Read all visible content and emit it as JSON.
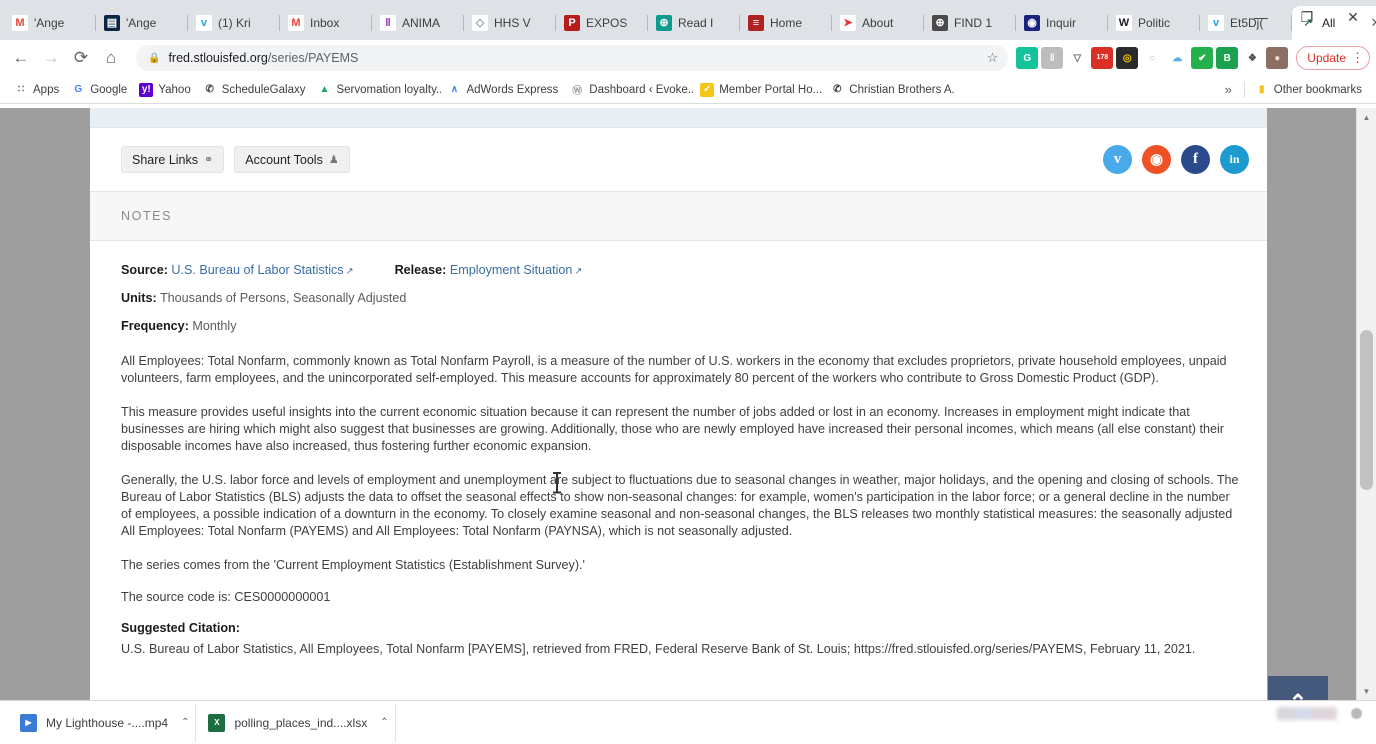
{
  "browser": {
    "tabs": [
      {
        "label": "'Ange",
        "favicon": "gmail-icon",
        "color": "#ea4335",
        "bg": "#ffffff",
        "glyph": "M",
        "active": false
      },
      {
        "label": "'Ange",
        "favicon": "handshake-icon",
        "color": "#ffffff",
        "bg": "#0b2545",
        "glyph": "▤",
        "active": false
      },
      {
        "label": "(1) Kri",
        "favicon": "twitter-icon",
        "color": "#1da1f2",
        "bg": "#ffffff",
        "glyph": "ᴠ",
        "active": false
      },
      {
        "label": "Inbox",
        "favicon": "gmail-icon",
        "color": "#ea4335",
        "bg": "#ffffff",
        "glyph": "M",
        "active": false
      },
      {
        "label": "ANIMA",
        "favicon": "bar-chart-icon",
        "color": "#8e24aa",
        "bg": "#ffffff",
        "glyph": "‖",
        "active": false
      },
      {
        "label": "HHS V",
        "favicon": "diamond-icon",
        "color": "#9aa0a6",
        "bg": "#ffffff",
        "glyph": "◇",
        "active": false
      },
      {
        "label": "EXPOS",
        "favicon": "pressreader-icon",
        "color": "#ffffff",
        "bg": "#b71c1c",
        "glyph": "P",
        "active": false
      },
      {
        "label": "Read I",
        "favicon": "globe-icon",
        "color": "#ffffff",
        "bg": "#0f9b8e",
        "glyph": "⊕",
        "active": false
      },
      {
        "label": "Home",
        "favicon": "flag-icon",
        "color": "#ffffff",
        "bg": "#b02121",
        "glyph": "≡",
        "active": false
      },
      {
        "label": "About",
        "favicon": "rocket-icon",
        "color": "#e53935",
        "bg": "#ffffff",
        "glyph": "➤",
        "active": false
      },
      {
        "label": "FIND 1",
        "favicon": "globe-dark-icon",
        "color": "#ffffff",
        "bg": "#4a4a4a",
        "glyph": "⊕",
        "active": false
      },
      {
        "label": "Inquir",
        "favicon": "record-icon",
        "color": "#ffffff",
        "bg": "#1a237e",
        "glyph": "◉",
        "active": false
      },
      {
        "label": "Politic",
        "favicon": "wikipedia-icon",
        "color": "#202124",
        "bg": "#ffffff",
        "glyph": "W",
        "active": false
      },
      {
        "label": "Et5Dj(",
        "favicon": "twitter-icon",
        "color": "#1da1f2",
        "bg": "#ffffff",
        "glyph": "ᴠ",
        "active": false
      },
      {
        "label": "All",
        "favicon": "fred-chart-icon",
        "color": "#2f6d4f",
        "bg": "#ffffff",
        "glyph": "↗",
        "active": true
      }
    ],
    "new_tab_label": "+",
    "window_controls": {
      "minimize": "—",
      "maximize": "❐",
      "close": "✕"
    },
    "nav": {
      "back": "←",
      "forward": "→",
      "reload": "⟳",
      "home": "⌂"
    },
    "omnibox": {
      "lock_icon": "lock-icon",
      "url_domain": "fred.stlouisfed.org",
      "url_path": "/series/PAYEMS",
      "bookmark_star": "☆"
    },
    "extensions": [
      {
        "name": "grammarly-extension",
        "glyph": "G",
        "bg": "#15c39a",
        "color": "#ffffff"
      },
      {
        "name": "gray-extension",
        "glyph": "‖",
        "bg": "#bdbdbd",
        "color": "#ffffff"
      },
      {
        "name": "shield-extension",
        "glyph": "▽",
        "bg": "#ffffff",
        "color": "#6b7280"
      },
      {
        "name": "gmail-checker-extension",
        "glyph": "178",
        "bg": "#d93025",
        "color": "#ffffff"
      },
      {
        "name": "clock-extension",
        "glyph": "◎",
        "bg": "#2b2b2b",
        "color": "#f6c700"
      },
      {
        "name": "circle-gray-extension",
        "glyph": "○",
        "bg": "#ffffff",
        "color": "#b0b0b0"
      },
      {
        "name": "cloud-extension",
        "glyph": "☁",
        "bg": "#ffffff",
        "color": "#5aaee0"
      },
      {
        "name": "checkmark-extension",
        "glyph": "✔",
        "bg": "#22b14c",
        "color": "#ffffff"
      },
      {
        "name": "bitly-extension",
        "glyph": "B",
        "bg": "#1ba14f",
        "color": "#ffffff"
      },
      {
        "name": "puzzle-extension",
        "glyph": "❖",
        "bg": "#ffffff",
        "color": "#4d5156"
      },
      {
        "name": "profile-avatar",
        "glyph": "●",
        "bg": "#8d6e63",
        "color": "#f3d9c8"
      }
    ],
    "update_button": {
      "label": "Update",
      "kebab": "⋮"
    },
    "bookmarks": [
      {
        "label": "Apps",
        "icon": "apps-grid-icon",
        "glyph": "∷",
        "bg": "#ffffff",
        "color": "#5f6368"
      },
      {
        "label": "Google",
        "icon": "google-icon",
        "glyph": "G",
        "bg": "#ffffff",
        "color": "#4285f4"
      },
      {
        "label": "Yahoo",
        "icon": "yahoo-icon",
        "glyph": "y!",
        "bg": "#6001d2",
        "color": "#ffffff"
      },
      {
        "label": "ScheduleGalaxy",
        "icon": "phone-icon",
        "glyph": "✆",
        "bg": "#ffffff",
        "color": "#3c4043"
      },
      {
        "label": "Servomation loyalty...",
        "icon": "google-drive-icon",
        "glyph": "▲",
        "bg": "#ffffff",
        "color": "#1aa260"
      },
      {
        "label": "AdWords Express",
        "icon": "adwords-icon",
        "glyph": "∧",
        "bg": "#ffffff",
        "color": "#4285f4"
      },
      {
        "label": "Dashboard ‹ Evoke...",
        "icon": "wordpress-icon",
        "glyph": "Ⓦ",
        "bg": "#ffffff",
        "color": "#9aa0a6"
      },
      {
        "label": "Member Portal Ho...",
        "icon": "check-badge-icon",
        "glyph": "✓",
        "bg": "#f5c518",
        "color": "#ffffff"
      },
      {
        "label": "Christian Brothers A...",
        "icon": "phone-icon",
        "glyph": "✆",
        "bg": "#ffffff",
        "color": "#3c4043"
      }
    ],
    "overflow_chevron": "»",
    "other_bookmarks": {
      "label": "Other bookmarks",
      "icon": "folder-icon",
      "glyph": "▮"
    }
  },
  "page": {
    "toolbar": {
      "share_links": {
        "label": "Share Links",
        "icon": "link-icon",
        "glyph": "⚭"
      },
      "account_tools": {
        "label": "Account Tools",
        "icon": "person-icon",
        "glyph": "♟"
      }
    },
    "social": [
      {
        "name": "twitter-share-icon",
        "glyph": "ᴠ",
        "bg": "#4aa9e8"
      },
      {
        "name": "reddit-share-icon",
        "glyph": "◉",
        "bg": "#ef5124"
      },
      {
        "name": "facebook-share-icon",
        "glyph": "f",
        "bg": "#2b4a8b"
      },
      {
        "name": "linkedin-share-icon",
        "glyph": "in",
        "bg": "#1d9bd1"
      }
    ],
    "notes_header": "NOTES",
    "meta": {
      "source_label": "Source:",
      "source_value": "U.S. Bureau of Labor Statistics",
      "release_label": "Release:",
      "release_value": "Employment Situation",
      "units_label": "Units:",
      "units_value": "Thousands of Persons, Seasonally Adjusted",
      "frequency_label": "Frequency:",
      "frequency_value": "Monthly"
    },
    "paragraphs": [
      "All Employees: Total Nonfarm, commonly known as Total Nonfarm Payroll, is a measure of the number of U.S. workers in the economy that excludes proprietors, private household employees, unpaid volunteers, farm employees, and the unincorporated self-employed. This measure accounts for approximately 80 percent of the workers who contribute to Gross Domestic Product (GDP).",
      "This measure provides useful insights into the current economic situation because it can represent the number of jobs added or lost in an economy. Increases in employment might indicate that businesses are hiring which might also suggest that businesses are growing. Additionally, those who are newly employed have increased their personal incomes, which means (all else constant) their disposable incomes have also increased, thus fostering further economic expansion.",
      "Generally, the U.S. labor force and levels of employment and unemployment are subject to fluctuations due to seasonal changes in weather, major holidays, and the opening and closing of schools. The Bureau of Labor Statistics (BLS) adjusts the data to offset the seasonal effects to show non-seasonal changes: for example, women's participation in the labor force; or a general decline in the number of employees, a possible indication of a downturn in the economy. To closely examine seasonal and non-seasonal changes, the BLS releases two monthly statistical measures: the seasonally adjusted All Employees: Total Nonfarm (PAYEMS) and All Employees: Total Nonfarm (PAYNSA), which is not seasonally adjusted.",
      "The series comes from the 'Current Employment Statistics (Establishment Survey).'",
      "The source code is: CES0000000001"
    ],
    "citation_heading": "Suggested Citation:",
    "citation_text": "U.S. Bureau of Labor Statistics, All Employees, Total Nonfarm [PAYEMS], retrieved from FRED, Federal Reserve Bank of St. Louis; https://fred.stlouisfed.org/series/PAYEMS, February 11, 2021.",
    "back_to_top": {
      "name": "back-to-top-button",
      "glyph": "⌃"
    }
  },
  "scrollbar": {
    "up_arrow": "▲",
    "down_arrow": "▼"
  },
  "taskbar": {
    "downloads": [
      {
        "name": "My Lighthouse -....mp4",
        "icon": "video-file-icon",
        "glyph": "▶",
        "bg": "#3a7bd5",
        "chevron": "⌃"
      },
      {
        "name": "polling_places_ind....xlsx",
        "icon": "excel-file-icon",
        "glyph": "X",
        "bg": "#1d6f42",
        "chevron": "⌃"
      }
    ]
  }
}
